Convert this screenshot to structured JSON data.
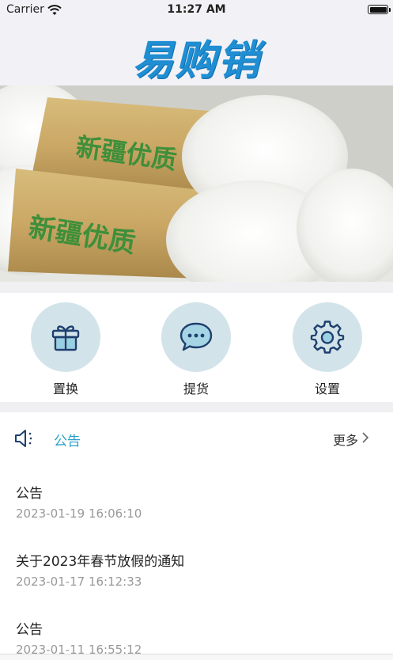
{
  "status_bar": {
    "carrier": "Carrier",
    "time": "11:27 AM"
  },
  "header": {
    "logo_text": "易购销"
  },
  "banner": {
    "slide_text": "新疆优质",
    "page_indicator": {
      "count": 1,
      "active": 1
    }
  },
  "shortcuts": [
    {
      "label": "置换",
      "icon": "gift-icon"
    },
    {
      "label": "提货",
      "icon": "chat-bubble-icon"
    },
    {
      "label": "设置",
      "icon": "gear-icon"
    }
  ],
  "notices": {
    "title": "公告",
    "more_label": "更多",
    "items": [
      {
        "title": "公告",
        "date": "2023-01-19 16:06:10"
      },
      {
        "title": "关于2023年春节放假的通知",
        "date": "2023-01-17 16:12:33"
      },
      {
        "title": "公告",
        "date": "2023-01-11 16:55:12"
      }
    ]
  },
  "colors": {
    "accent": "#2aa0c9",
    "logo": "#1f8ed3",
    "icon_bg": "#d2e4ea",
    "icon_stroke": "#1e3f6e"
  }
}
